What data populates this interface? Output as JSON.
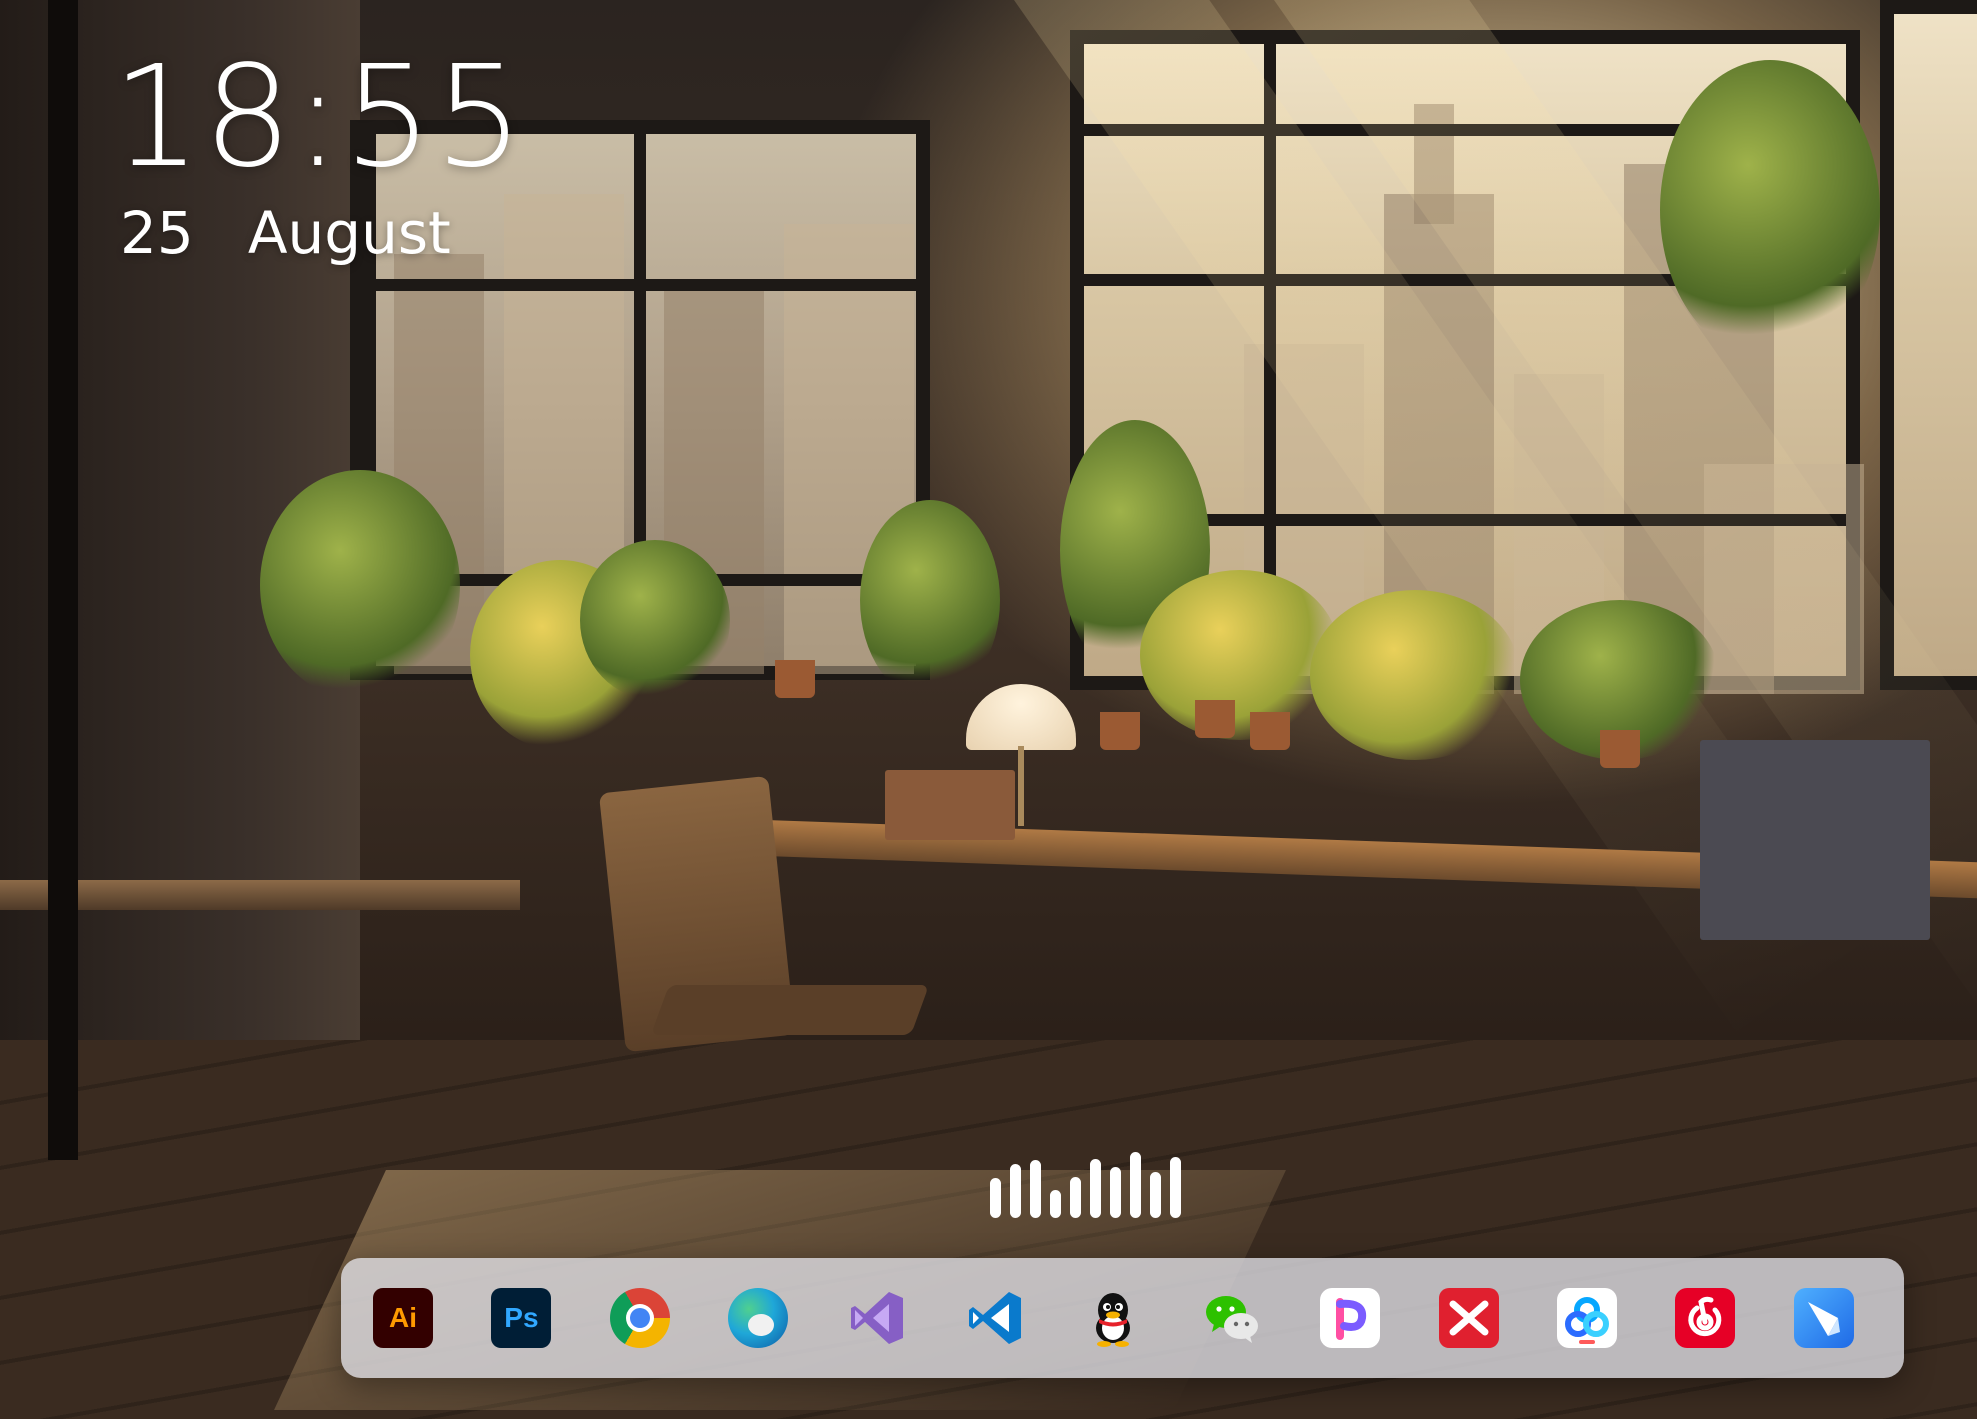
{
  "clock": {
    "time": "18:55",
    "day": "25",
    "month": "August"
  },
  "visualizer": {
    "name": "audio-visualizer",
    "bar_levels": [
      0.6,
      0.82,
      0.88,
      0.42,
      0.62,
      0.9,
      0.78,
      1.0,
      0.7,
      0.92
    ]
  },
  "dock": {
    "apps": [
      {
        "id": "illustrator",
        "label": "Ai",
        "icon": "adobe-illustrator-icon"
      },
      {
        "id": "photoshop",
        "label": "Ps",
        "icon": "adobe-photoshop-icon"
      },
      {
        "id": "chrome",
        "icon": "chrome-icon"
      },
      {
        "id": "edge",
        "icon": "edge-icon"
      },
      {
        "id": "visual-studio",
        "icon": "visual-studio-icon"
      },
      {
        "id": "vscode",
        "icon": "vscode-icon"
      },
      {
        "id": "qq",
        "icon": "qq-penguin-icon"
      },
      {
        "id": "wechat",
        "icon": "wechat-icon"
      },
      {
        "id": "pin",
        "icon": "pin-app-icon"
      },
      {
        "id": "xmind",
        "icon": "xmind-icon"
      },
      {
        "id": "baidu-netdisk",
        "icon": "baidu-netdisk-icon"
      },
      {
        "id": "netease-music",
        "icon": "netease-cloud-music-icon"
      },
      {
        "id": "feishu",
        "icon": "feishu-icon"
      }
    ]
  },
  "colors": {
    "clock_text": "#ffffff",
    "dock_background": "rgba(225,225,232,0.78)"
  }
}
